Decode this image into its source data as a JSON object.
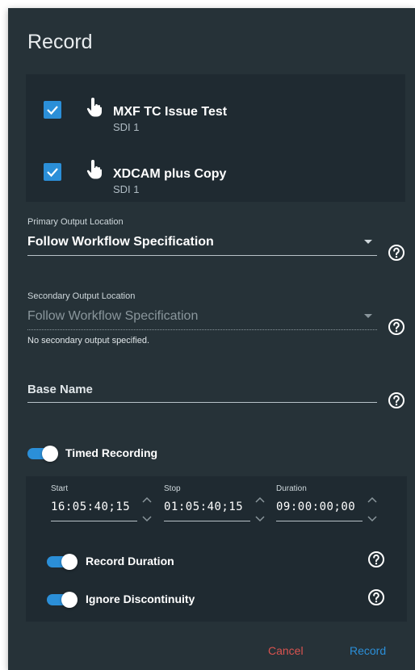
{
  "dialog": {
    "title": "Record"
  },
  "sources": [
    {
      "name": "MXF TC Issue Test",
      "input": "SDI 1",
      "checked": true
    },
    {
      "name": "XDCAM plus Copy",
      "input": "SDI 1",
      "checked": true
    }
  ],
  "primary_output": {
    "label": "Primary Output Location",
    "value": "Follow Workflow Specification"
  },
  "secondary_output": {
    "label": "Secondary Output Location",
    "value": "Follow Workflow Specification",
    "hint": "No secondary output specified."
  },
  "base_name": {
    "placeholder": "Base Name"
  },
  "timed_recording": {
    "label": "Timed Recording",
    "enabled": true,
    "start": {
      "label": "Start",
      "value": "16:05:40;15"
    },
    "stop": {
      "label": "Stop",
      "value": "01:05:40;15"
    },
    "duration": {
      "label": "Duration",
      "value": "09:00:00;00"
    },
    "record_duration": {
      "label": "Record Duration",
      "enabled": true
    },
    "ignore_discontinuity": {
      "label": "Ignore Discontinuity",
      "enabled": true
    }
  },
  "footer": {
    "cancel_label": "Cancel",
    "record_label": "Record"
  },
  "colors": {
    "accent": "#2b8fd8",
    "cancel": "#d9534f",
    "background": "#263238"
  },
  "icons": {
    "checkbox": "checkmark-icon",
    "source": "hand-pointer-icon",
    "help": "question-circle-icon"
  }
}
